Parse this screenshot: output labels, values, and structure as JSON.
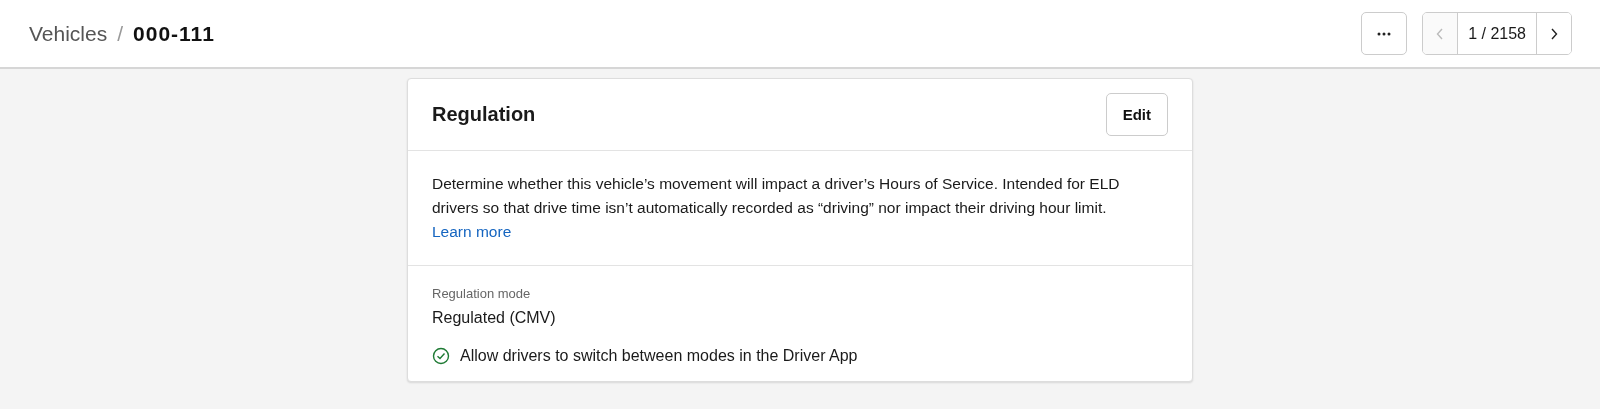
{
  "breadcrumb": {
    "parent": "Vehicles",
    "separator": "/",
    "current": "000-111"
  },
  "pager": {
    "position": "1 / 2158",
    "prev_disabled": true,
    "next_disabled": false
  },
  "card": {
    "title": "Regulation",
    "edit_button": "Edit",
    "description": "Determine whether this vehicle’s movement will impact a driver’s Hours of Service. Intended for ELD drivers so that drive time isn’t automatically recorded as “driving” nor impact their driving hour limit.",
    "link": "Learn more",
    "field_label": "Regulation mode",
    "field_value": "Regulated (CMV)",
    "option": {
      "label": "Allow drivers to switch between modes in the Driver App",
      "checked": true
    }
  }
}
